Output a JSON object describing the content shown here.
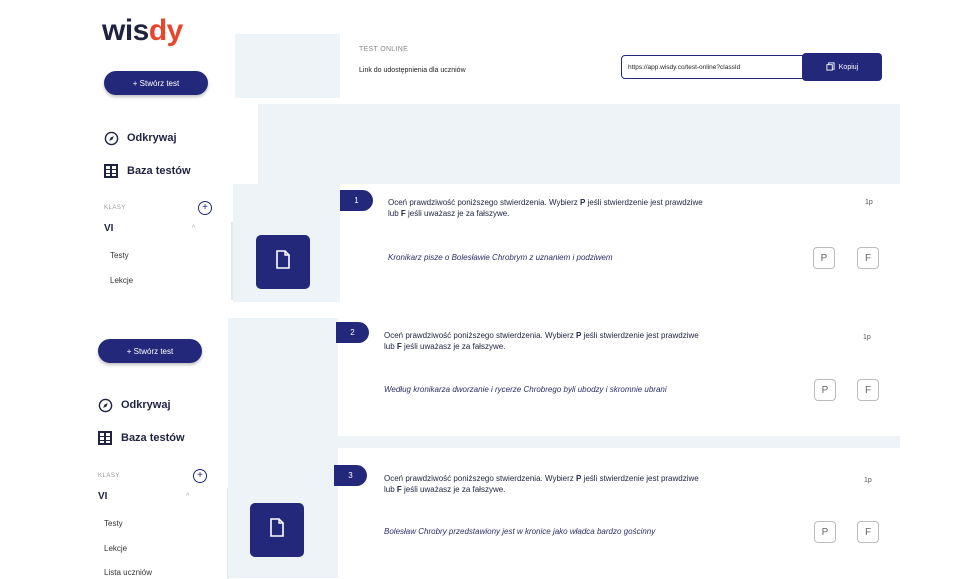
{
  "brand": {
    "logo_main": "wis",
    "logo_accent": "dy"
  },
  "sidebars": [
    {
      "create_label": "+ Stwórz test",
      "nav_explore": "Odkrywaj",
      "nav_bank": "Baza testów",
      "classes_header": "KLASY",
      "class_name": "VI",
      "subitems": [
        "Testy",
        "Lekcje"
      ]
    },
    {
      "create_label": "+ Stwórz test",
      "nav_explore": "Odkrywaj",
      "nav_bank": "Baza testów",
      "classes_header": "KLASY",
      "class_name": "VI",
      "subitems": [
        "Testy",
        "Lekcje",
        "Lista uczniów"
      ]
    }
  ],
  "header": {
    "title": "TEST ONLINE",
    "share_label": "Link do udostępnienia dla uczniów",
    "share_url": "https://app.wisdy.co/test-online?classId",
    "copy_label": "Kopiuj"
  },
  "questions": [
    {
      "number": "1",
      "text_a": "Oceń prawdziwość poniższego stwierdzenia. Wybierz ",
      "bold_p": "P",
      "text_b": " jeśli stwierdzenie jest prawdziwe",
      "text_c": "lub ",
      "bold_f": "F",
      "text_d": " jeśli uważasz je za fałszywe.",
      "points": "1p",
      "statement": "Kronikarz pisze o Bolesławie Chrobrym z uznaniem i podziwem",
      "opt_p": "P",
      "opt_f": "F"
    },
    {
      "number": "2",
      "text_a": "Oceń prawdziwość poniższego stwierdzenia. Wybierz ",
      "bold_p": "P",
      "text_b": " jeśli stwierdzenie jest prawdziwe",
      "text_c": "lub ",
      "bold_f": "F",
      "text_d": " jeśli uważasz je za fałszywe.",
      "points": "1p",
      "statement": "Według kronikarza dworzanie i rycerze Chrobrego byli ubodzy i skromnie ubrani",
      "opt_p": "P",
      "opt_f": "F"
    },
    {
      "number": "3",
      "text_a": "Oceń prawdziwość poniższego stwierdzenia. Wybierz ",
      "bold_p": "P",
      "text_b": " jeśli stwierdzenie jest prawdziwe",
      "text_c": "lub ",
      "bold_f": "F",
      "text_d": " jeśli uważasz je za fałszywe.",
      "points": "1p",
      "statement": "Bolesław Chrobry przedstawiony jest w kronice jako władca bardzo gościnny",
      "opt_p": "P",
      "opt_f": "F"
    }
  ]
}
